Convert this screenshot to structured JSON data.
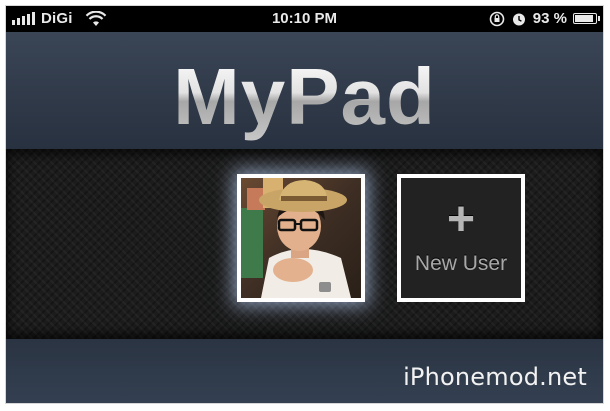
{
  "status_bar": {
    "carrier": "DiGi",
    "time": "10:10 PM",
    "battery_text": "93 %",
    "battery_level": 0.93,
    "signal_bars": 5,
    "icons": [
      "signal-icon",
      "wifi-icon",
      "rotation-lock-icon",
      "alarm-icon",
      "battery-icon"
    ]
  },
  "app": {
    "title": "MyPad"
  },
  "users": [
    {
      "type": "photo",
      "avatar": "user-avatar-photo"
    },
    {
      "type": "add",
      "plus_symbol": "+",
      "label": "New User"
    }
  ],
  "watermark": "iPhonemod.net"
}
